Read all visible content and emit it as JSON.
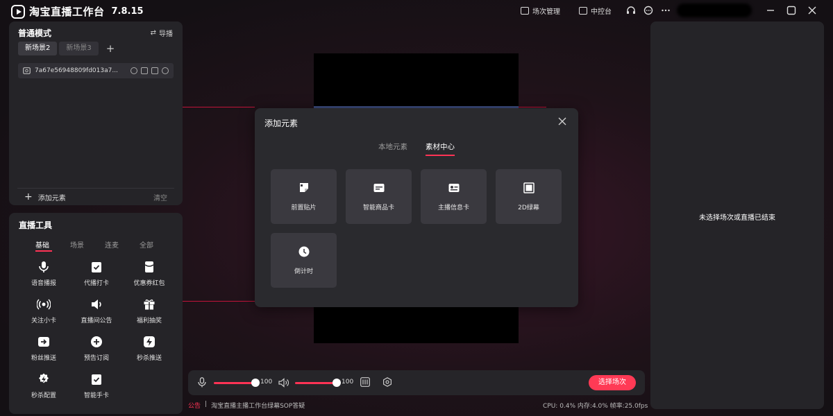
{
  "app": {
    "title": "淘宝直播工作台",
    "version": "7.8.15"
  },
  "titlebar": {
    "scene_manage": "场次管理",
    "control_center": "中控台"
  },
  "left_top": {
    "mode_title": "普通模式",
    "guide_label": "导播",
    "scenes": [
      "新场景2",
      "新场景3"
    ],
    "layer_name": "7a67e56948809fd013a7...",
    "add_element": "添加元素",
    "clear": "清空"
  },
  "tools": {
    "title": "直播工具",
    "tabs": [
      "基础",
      "场景",
      "连麦",
      "全部"
    ],
    "items": [
      "语音播报",
      "代播打卡",
      "优惠券红包",
      "关注小卡",
      "直播间公告",
      "福利抽奖",
      "粉丝推送",
      "预告订阅",
      "秒杀推送",
      "秒杀配置",
      "智能手卡"
    ]
  },
  "modal": {
    "title": "添加元素",
    "tabs": [
      "本地元素",
      "素材中心"
    ],
    "cards": [
      "前置贴片",
      "智能商品卡",
      "主播信息卡",
      "2D绿幕",
      "倒计时"
    ]
  },
  "controls": {
    "mic_volume": "100",
    "speaker_volume": "100",
    "mic_level": 1.0,
    "speaker_level": 1.0,
    "select_scene": "选择场次"
  },
  "footer": {
    "notice_tag": "公告",
    "notice_text": "淘宝直播主播工作台绿幕SOP答疑",
    "stats": "CPU: 0.4% 内存:4.0% 帧率:25.0fps"
  },
  "right": {
    "message": "未选择场次或直播已结束"
  },
  "colors": {
    "accent": "#ff3355",
    "panel": "#252428",
    "modal": "#2a2a2e"
  }
}
